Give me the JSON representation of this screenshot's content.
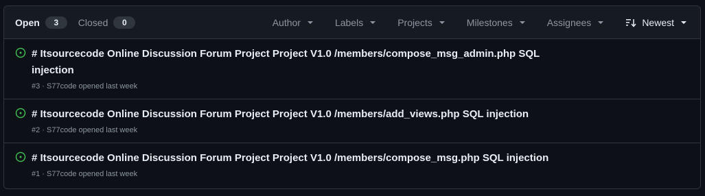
{
  "states": {
    "open_label": "Open",
    "open_count": "3",
    "closed_label": "Closed",
    "closed_count": "0"
  },
  "filters": {
    "author": "Author",
    "labels": "Labels",
    "projects": "Projects",
    "milestones": "Milestones",
    "assignees": "Assignees",
    "sort": "Newest"
  },
  "icons": {
    "open_issue": "issue-opened-icon",
    "sort": "sort-desc-icon",
    "caret": "triangle-down-icon"
  },
  "colors": {
    "open_issue": "#3fb950",
    "text_muted": "#8d96a0",
    "background": "#0d1117",
    "header_bg": "#161b22",
    "border": "#30363d"
  },
  "issues": [
    {
      "title": "# Itsourcecode Online Discussion Forum Project Project V1.0 /members/compose_msg_admin.php SQL injection",
      "meta": "#3 · S77code opened last week"
    },
    {
      "title": "# Itsourcecode Online Discussion Forum Project Project V1.0 /members/add_views.php SQL injection",
      "meta": "#2 · S77code opened last week"
    },
    {
      "title": "# Itsourcecode Online Discussion Forum Project Project V1.0 /members/compose_msg.php SQL injection",
      "meta": "#1 · S77code opened last week"
    }
  ]
}
